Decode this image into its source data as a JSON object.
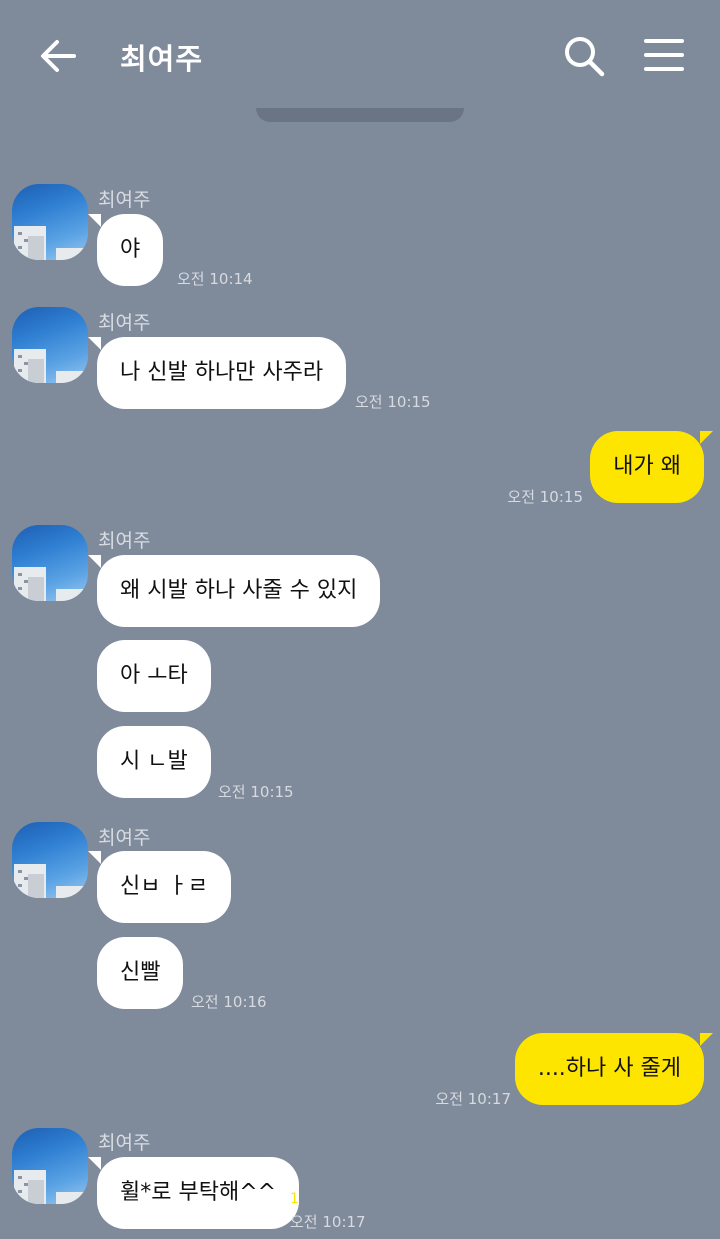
{
  "header": {
    "title": "최여주",
    "back_icon": "arrow-left-icon",
    "search_icon": "search-icon",
    "menu_icon": "hamburger-menu-icon"
  },
  "colors": {
    "background": "#7f8a9b",
    "incoming_bubble": "#ffffff",
    "outgoing_bubble": "#fee500",
    "unread_count": "#fee500"
  },
  "messages": [
    {
      "sender": "최여주",
      "text": "야",
      "time": "오전 10:14"
    },
    {
      "sender": "최여주",
      "text": "나 신발 하나만 사주라",
      "time": "오전 10:15"
    },
    {
      "text": "내가 왜",
      "time": "오전 10:15"
    },
    {
      "sender": "최여주",
      "text": "왜 시발 하나 사줄 수 있지"
    },
    {
      "text": "아 ㅗ타"
    },
    {
      "text": "시 ㄴ발",
      "time": "오전 10:15"
    },
    {
      "sender": "최여주",
      "text": "신ㅂ ㅏㄹ"
    },
    {
      "text": "신빨",
      "time": "오전 10:16"
    },
    {
      "text": "....하나 사 줄게",
      "time": "오전 10:17"
    },
    {
      "sender": "최여주",
      "text": "휠*로 부탁해^^",
      "time": "오전 10:17",
      "unread": "1"
    }
  ]
}
